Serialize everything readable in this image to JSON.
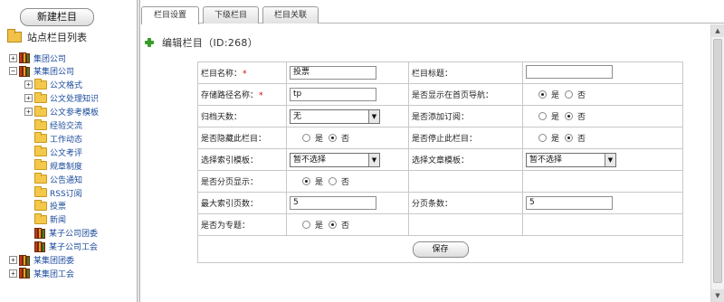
{
  "sidebar": {
    "new_button": "新建栏目",
    "root_label": "站点栏目列表",
    "tree": [
      {
        "label": "集团公司",
        "icon": "books-icon",
        "expander": "+",
        "level": 0
      },
      {
        "label": "某集团公司",
        "icon": "books-icon",
        "expander": "−",
        "level": 0
      },
      {
        "label": "公文格式",
        "icon": "folder-icon",
        "expander": "+",
        "level": 1
      },
      {
        "label": "公文处理知识",
        "icon": "folder-icon",
        "expander": "+",
        "level": 1
      },
      {
        "label": "公文参考模板",
        "icon": "folder-icon",
        "expander": "+",
        "level": 1
      },
      {
        "label": "经验交流",
        "icon": "folder-icon",
        "expander": "",
        "level": 1
      },
      {
        "label": "工作动态",
        "icon": "folder-icon",
        "expander": "",
        "level": 1
      },
      {
        "label": "公文考评",
        "icon": "folder-icon",
        "expander": "",
        "level": 1
      },
      {
        "label": "规章制度",
        "icon": "folder-icon",
        "expander": "",
        "level": 1
      },
      {
        "label": "公告通知",
        "icon": "folder-icon",
        "expander": "",
        "level": 1
      },
      {
        "label": "RSS订阅",
        "icon": "folder-icon",
        "expander": "",
        "level": 1
      },
      {
        "label": "投票",
        "icon": "folder-icon",
        "expander": "",
        "level": 1
      },
      {
        "label": "新闻",
        "icon": "folder-icon",
        "expander": "",
        "level": 1
      },
      {
        "label": "某子公司团委",
        "icon": "books-icon",
        "expander": "",
        "level": 1
      },
      {
        "label": "某子公司工会",
        "icon": "books-icon",
        "expander": "",
        "level": 1
      },
      {
        "label": "某集团团委",
        "icon": "books-icon",
        "expander": "+",
        "level": 0
      },
      {
        "label": "某集团工会",
        "icon": "books-icon",
        "expander": "+",
        "level": 0
      }
    ]
  },
  "tabs": [
    {
      "label": "栏目设置",
      "active": true
    },
    {
      "label": "下级栏目",
      "active": false
    },
    {
      "label": "栏目关联",
      "active": false
    }
  ],
  "panel": {
    "title": "编辑栏目（ID:268）",
    "icon": "plus-icon"
  },
  "form": {
    "name_label": "栏目名称：",
    "name_value": "投票",
    "title_label": "栏目标题：",
    "title_value": "",
    "path_label": "存储路径名称：",
    "path_value": "tp",
    "show_nav_label": "是否显示在首页导航：",
    "archive_label": "归档天数：",
    "archive_value": "无",
    "subscribe_label": "是否添加订阅：",
    "hide_label": "是否隐藏此栏目：",
    "stop_label": "是否停止此栏目：",
    "index_tpl_label": "选择索引模板：",
    "index_tpl_value": "暂不选择",
    "article_tpl_label": "选择文章模板：",
    "article_tpl_value": "暂不选择",
    "paging_label": "是否分页显示：",
    "max_index_label": "最大索引页数：",
    "max_index_value": "5",
    "page_count_label": "分页条数：",
    "page_count_value": "5",
    "topic_label": "是否为专题：",
    "yes": "是",
    "no": "否",
    "required_mark": "*",
    "save_button": "保存",
    "select_arrow": "▼"
  },
  "radio_state": {
    "show_nav": "yes",
    "subscribe": "no",
    "hide": "no",
    "stop": "no",
    "paging": "yes",
    "topic": "no"
  }
}
